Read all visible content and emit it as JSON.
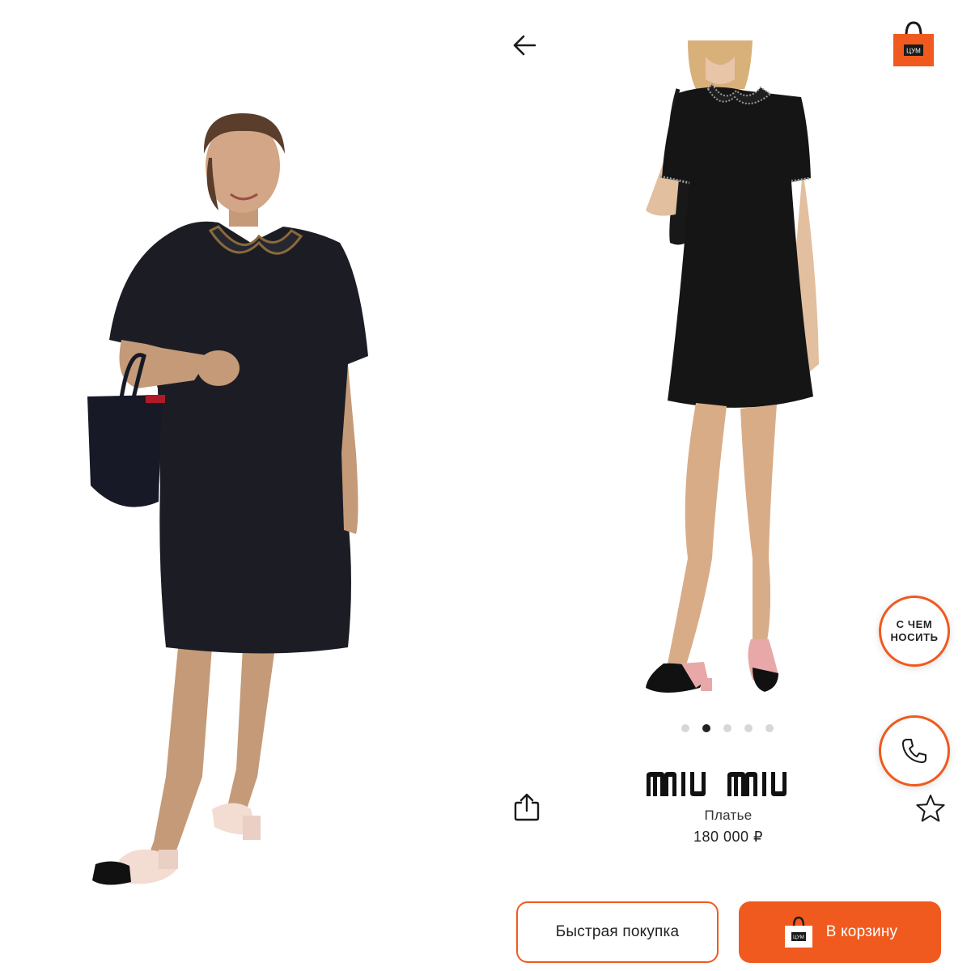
{
  "left_panel": {
    "photo": "lifestyle-model-photo"
  },
  "header": {
    "back_icon": "arrow-left-icon",
    "cart_icon": "shopping-bag-icon",
    "cart_logo_text": "ЦУМ"
  },
  "product": {
    "photo": "product-model-photo",
    "brand": "miu miu",
    "type": "Платье",
    "price": "180 000 ₽"
  },
  "gallery": {
    "total": 5,
    "active_index": 1
  },
  "actions": {
    "what_to_wear_line1": "С ЧЕМ",
    "what_to_wear_line2": "НОСИТЬ",
    "call_icon": "phone-icon",
    "share_icon": "share-icon",
    "favorite_icon": "star-icon",
    "quick_buy_label": "Быстрая покупка",
    "add_to_cart_label": "В корзину"
  },
  "colors": {
    "accent": "#f05a1e",
    "dress": "#1c1d24",
    "text": "#222222"
  }
}
